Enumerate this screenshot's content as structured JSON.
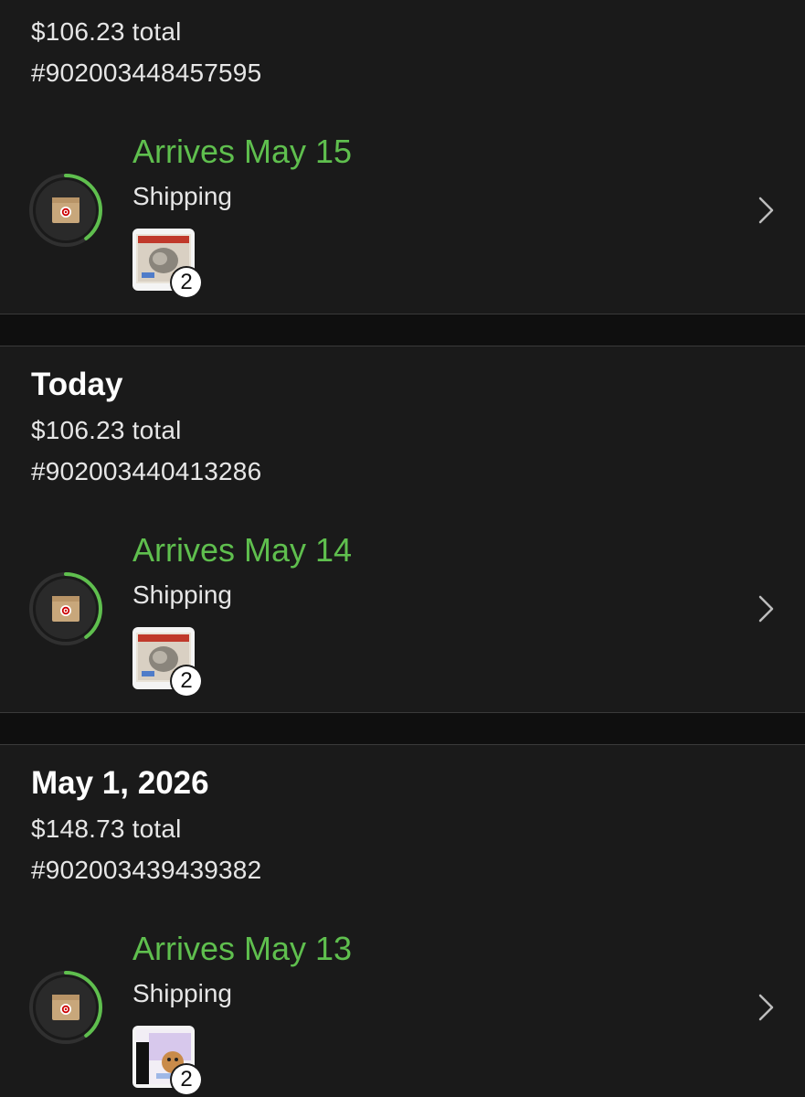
{
  "orders": [
    {
      "date": "",
      "total": "$106.23 total",
      "order_number": "#902003448457595",
      "arrives": "Arrives May 15",
      "status": "Shipping",
      "item_count": "2",
      "progress": 0.4,
      "box_icon": "package-target-icon",
      "thumb_icon": "trading-card-box-icon"
    },
    {
      "date": "Today",
      "total": "$106.23 total",
      "order_number": "#902003440413286",
      "arrives": "Arrives May 14",
      "status": "Shipping",
      "item_count": "2",
      "progress": 0.4,
      "box_icon": "package-target-icon",
      "thumb_icon": "trading-card-box-icon"
    },
    {
      "date": "May 1, 2026",
      "total": "$148.73 total",
      "order_number": "#902003439439382",
      "arrives": "Arrives May 13",
      "status": "Shipping",
      "item_count": "2",
      "progress": 0.4,
      "box_icon": "package-target-icon",
      "thumb_icon": "elite-trainer-box-icon"
    }
  ],
  "colors": {
    "accent_green": "#5fbf4e",
    "card_bg": "#1a1a1a",
    "page_bg": "#0f0f0f",
    "target_red": "#cc0000"
  }
}
